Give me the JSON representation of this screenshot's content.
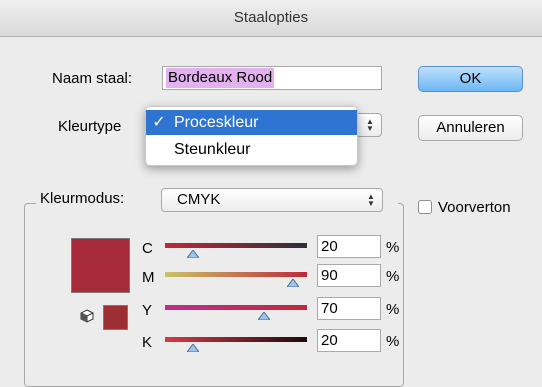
{
  "window": {
    "title": "Staalopties"
  },
  "name_field": {
    "label": "Naam staal:",
    "value": "Bordeaux Rood"
  },
  "buttons": {
    "ok": "OK",
    "cancel": "Annuleren"
  },
  "color_type": {
    "label": "Kleurtype",
    "menu": [
      {
        "label": "Proceskleur",
        "selected": true,
        "check": "✓"
      },
      {
        "label": "Steunkleur",
        "selected": false,
        "check": ""
      }
    ]
  },
  "color_mode": {
    "label": "Kleurmodus:",
    "value": "CMYK"
  },
  "preview": {
    "label": "Voorverton",
    "checked": false
  },
  "swatch": {
    "color": "#a72a3b",
    "gamut_color": "#9c2e34"
  },
  "channels": [
    {
      "name": "C",
      "value": "20",
      "unit": "%",
      "fraction": 0.2,
      "gradient": [
        "#c0283a",
        "#2b2f3a"
      ]
    },
    {
      "name": "M",
      "value": "90",
      "unit": "%",
      "fraction": 0.9,
      "gradient": [
        "#c9c468",
        "#c0283a"
      ]
    },
    {
      "name": "Y",
      "value": "70",
      "unit": "%",
      "fraction": 0.7,
      "gradient": [
        "#b8308a",
        "#c0283a"
      ]
    },
    {
      "name": "K",
      "value": "20",
      "unit": "%",
      "fraction": 0.2,
      "gradient": [
        "#d53a4a",
        "#1a0a0c"
      ]
    }
  ]
}
